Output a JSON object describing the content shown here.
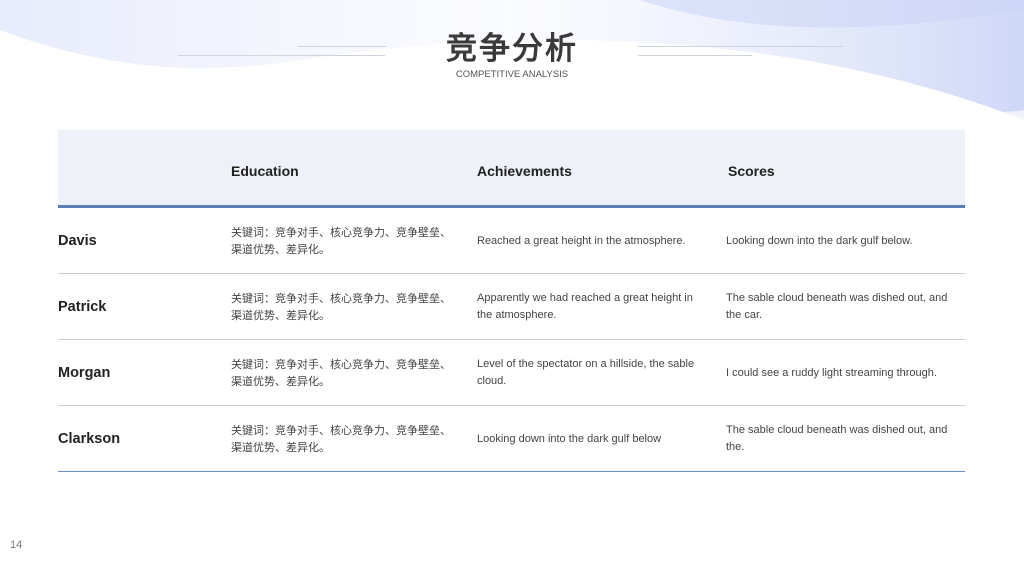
{
  "slide": {
    "title": "竞争分析",
    "subtitle": "COMPETITIVE ANALYSIS",
    "page_number": "14"
  },
  "table": {
    "headers": [
      "Education",
      "Achievements",
      "Scores"
    ],
    "rows": [
      {
        "name": "Davis",
        "education": "关键词：竞争对手、核心竞争力、竞争壁垒、渠道优势、差异化。",
        "achievements": "Reached a great height in the atmosphere.",
        "scores": "Looking down into the dark gulf below."
      },
      {
        "name": "Patrick",
        "education": "关键词：竞争对手、核心竞争力、竞争壁垒、渠道优势、差异化。",
        "achievements": "Apparently we had reached a great height in the atmosphere.",
        "scores": "The sable cloud beneath was dished out, and the car."
      },
      {
        "name": "Morgan",
        "education": "关键词：竞争对手、核心竞争力、竞争壁垒、渠道优势、差异化。",
        "achievements": "Level of the spectator on a hillside, the sable cloud.",
        "scores": "I could see a ruddy light streaming through."
      },
      {
        "name": "Clarkson",
        "education": "关键词：竞争对手、核心竞争力、竞争壁垒、渠道优势、差异化。",
        "achievements": "Looking down into the dark gulf below",
        "scores": "The sable cloud beneath was dished out, and the."
      }
    ]
  },
  "colors": {
    "header_bg": "#eef1f7",
    "accent_line": "#5b7fb5",
    "background_tint": "#c9d4f5"
  }
}
